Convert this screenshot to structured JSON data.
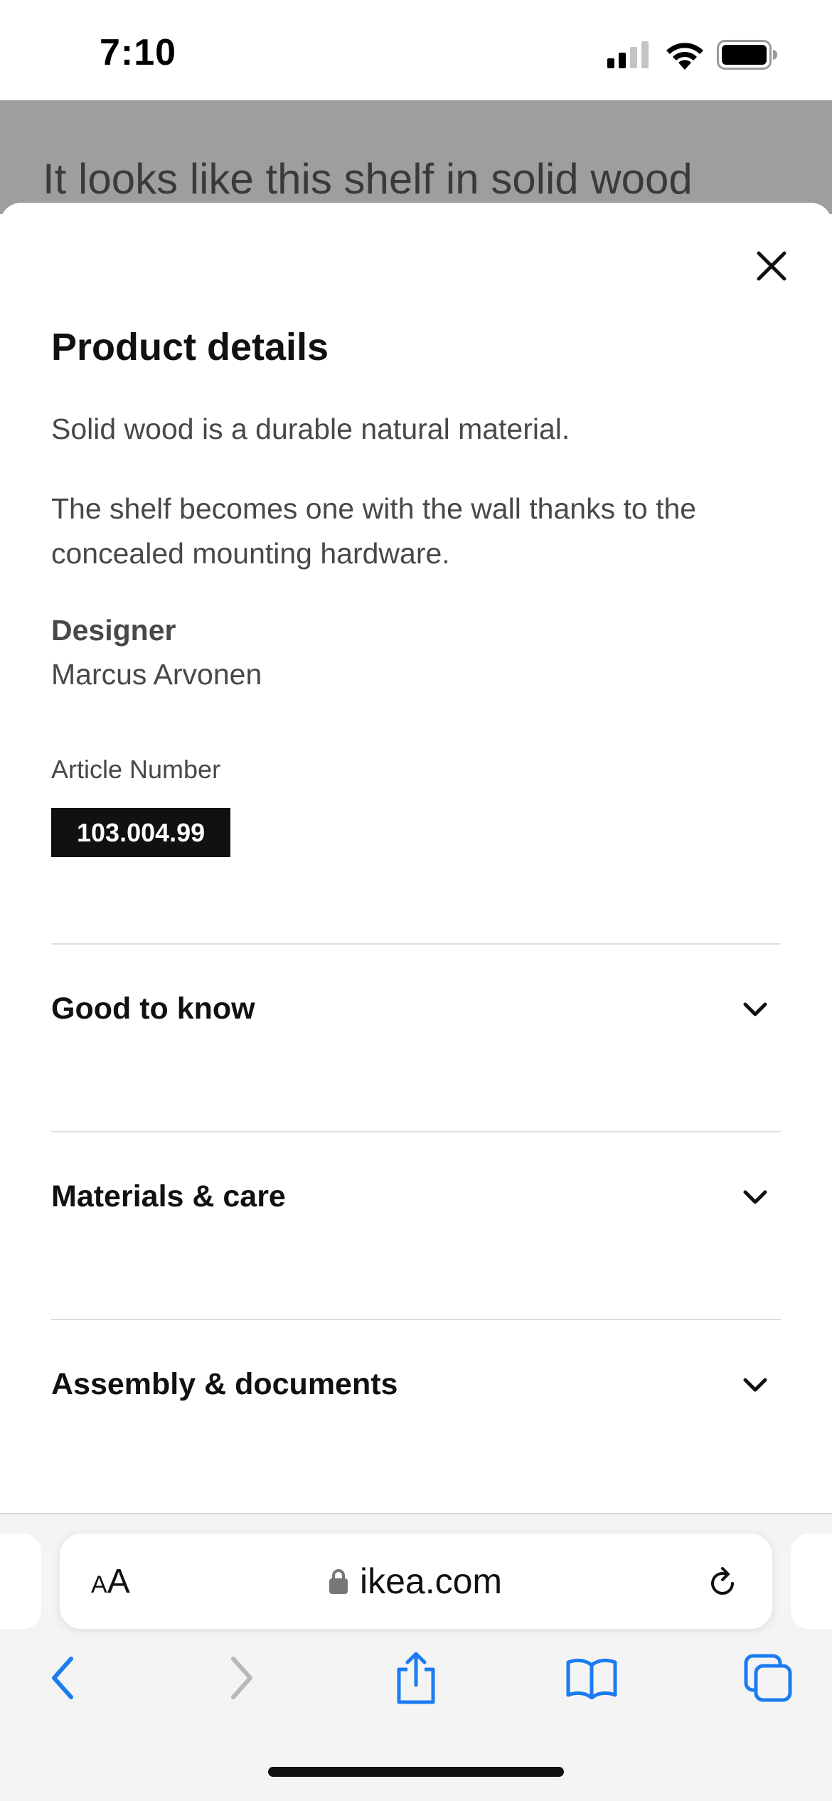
{
  "status_bar": {
    "time": "7:10",
    "signal_icon": "cellular-signal-icon",
    "wifi_icon": "wifi-icon",
    "battery_icon": "battery-icon"
  },
  "background_page": {
    "heading": "It looks like this shelf in solid wood"
  },
  "sheet": {
    "close_icon": "close-icon",
    "title": "Product details",
    "paragraphs": [
      "Solid wood is a durable natural material.",
      "The shelf becomes one with the wall thanks to the concealed mounting hardware."
    ],
    "designer": {
      "heading": "Designer",
      "name": "Marcus Arvonen"
    },
    "article": {
      "label": "Article Number",
      "number": "103.004.99"
    },
    "sections": [
      {
        "label": "Good to know",
        "icon": "chevron-down-icon"
      },
      {
        "label": "Materials & care",
        "icon": "chevron-down-icon"
      },
      {
        "label": "Assembly & documents",
        "icon": "chevron-down-icon"
      }
    ]
  },
  "browser": {
    "text_size": {
      "small": "A",
      "large": "A"
    },
    "url": "ikea.com",
    "icons": {
      "lock": "lock-icon",
      "reload": "reload-icon",
      "back": "back-arrow-icon",
      "forward": "forward-arrow-icon",
      "share": "share-icon",
      "bookmarks": "bookmarks-icon",
      "tabs": "tabs-icon"
    },
    "accent_color": "#1a7cf0"
  }
}
